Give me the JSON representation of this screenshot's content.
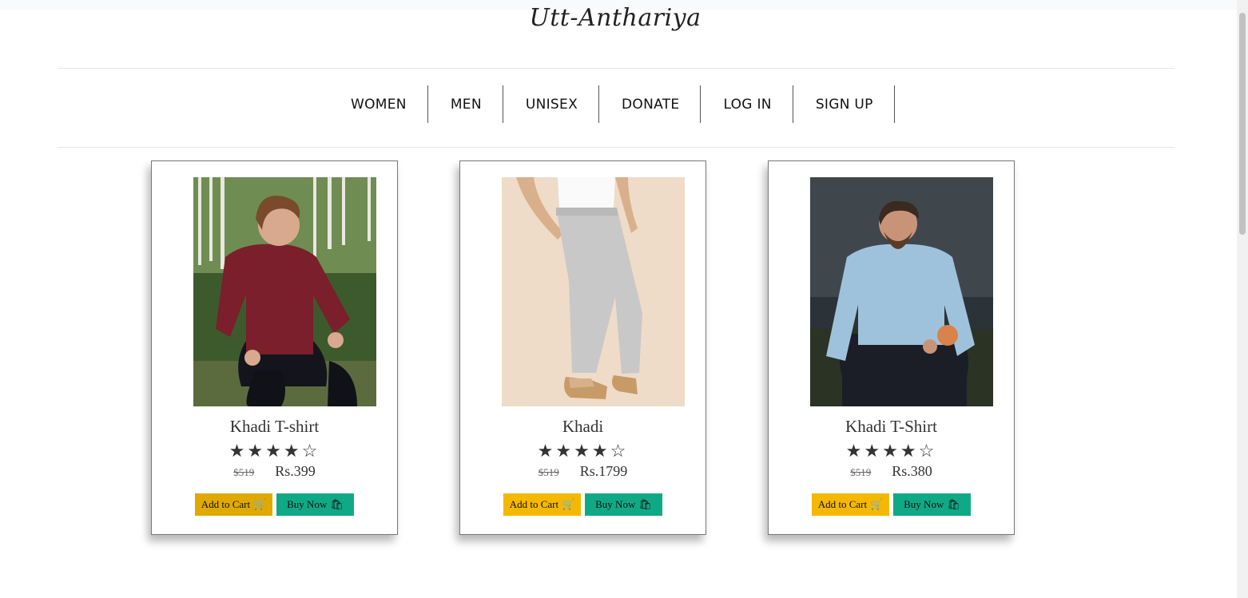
{
  "brand": {
    "logo_text": "Utt-Anthariya"
  },
  "nav": {
    "items": [
      "WOMEN",
      "MEN",
      "UNISEX",
      "DONATE",
      "LOG IN",
      "SIGN UP"
    ]
  },
  "products": [
    {
      "title": "Khadi T-shirt",
      "rating": 4,
      "max_rating": 5,
      "old_price": "$519",
      "price": "Rs.399",
      "add_to_cart_label": "Add to Cart",
      "buy_now_label": "Buy Now"
    },
    {
      "title": "Khadi",
      "rating": 4,
      "max_rating": 5,
      "old_price": "$519",
      "price": "Rs.1799",
      "add_to_cart_label": "Add to Cart",
      "buy_now_label": "Buy Now"
    },
    {
      "title": "Khadi T-Shirt",
      "rating": 4,
      "max_rating": 5,
      "old_price": "$519",
      "price": "Rs.380",
      "add_to_cart_label": "Add to Cart",
      "buy_now_label": "Buy Now"
    }
  ],
  "colors": {
    "add_to_cart": "#f5b800",
    "buy_now": "#10a986"
  }
}
